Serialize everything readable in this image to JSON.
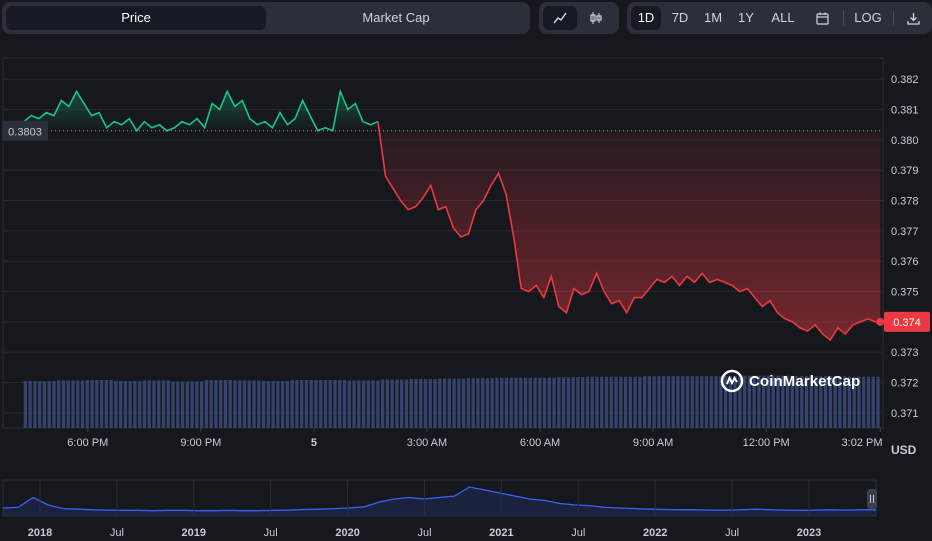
{
  "toolbar": {
    "tabs": [
      {
        "label": "Price",
        "active": true
      },
      {
        "label": "Market Cap",
        "active": false
      }
    ],
    "chart_type_icons": [
      {
        "name": "line-chart-icon",
        "active": true
      },
      {
        "name": "candlestick-icon",
        "active": false
      }
    ],
    "ranges": [
      {
        "label": "1D",
        "active": true
      },
      {
        "label": "7D",
        "active": false
      },
      {
        "label": "1M",
        "active": false
      },
      {
        "label": "1Y",
        "active": false
      },
      {
        "label": "ALL",
        "active": false
      }
    ],
    "calendar_icon": "calendar-icon",
    "log_label": "LOG",
    "download_icon": "download-icon"
  },
  "watermark": "CoinMarketCap",
  "currency_label": "USD",
  "colors": {
    "up": "#16c784",
    "down": "#ea3943",
    "volume": "#3a4a7a",
    "navigator_line": "#3861fb"
  },
  "chart_data": {
    "type": "line",
    "title": "",
    "xlabel": "",
    "ylabel": "",
    "ylim": [
      0.3705,
      0.3827
    ],
    "y_ticks": [
      0.382,
      0.381,
      0.38,
      0.379,
      0.378,
      0.377,
      0.376,
      0.375,
      0.374,
      0.373,
      0.372,
      0.371
    ],
    "y_tick_labels": [
      "0.382",
      "0.381",
      "0.380",
      "0.379",
      "0.378",
      "0.377",
      "0.376",
      "0.375",
      "0.374",
      "0.373",
      "0.372",
      "0.371"
    ],
    "x_tick_labels": [
      "6:00 PM",
      "9:00 PM",
      "5",
      "3:00 AM",
      "6:00 AM",
      "9:00 AM",
      "12:00 PM",
      "3:02 PM"
    ],
    "x_tick_hours": [
      18,
      21,
      24,
      27,
      30,
      33,
      36,
      39.03
    ],
    "reference_value": 0.3803,
    "reference_label": "0.3803",
    "current_value": 0.374,
    "current_label": "0.374",
    "grid": true,
    "series": [
      {
        "x": [
          16.3,
          16.5,
          16.7,
          16.9,
          17.1,
          17.3,
          17.5,
          17.7,
          17.9,
          18.1,
          18.3,
          18.5,
          18.7,
          18.9,
          19.1,
          19.3,
          19.5,
          19.7,
          19.9,
          20.1,
          20.3,
          20.5,
          20.7,
          20.9,
          21.1,
          21.3,
          21.5,
          21.7,
          21.9,
          22.1,
          22.3,
          22.5,
          22.7,
          22.9,
          23.1,
          23.3,
          23.5,
          23.7,
          23.9,
          24.1,
          24.3,
          24.5,
          24.7,
          24.9,
          25.1,
          25.3,
          25.5,
          25.7,
          25.9,
          26.1,
          26.3,
          26.5,
          26.7,
          26.9,
          27.1,
          27.3,
          27.5,
          27.7,
          27.9,
          28.1,
          28.3,
          28.5,
          28.7,
          28.9,
          29.1,
          29.3,
          29.5,
          29.7,
          29.9,
          30.1,
          30.3,
          30.5,
          30.7,
          30.9,
          31.1,
          31.3,
          31.5,
          31.7,
          31.9,
          32.1,
          32.3,
          32.5,
          32.7,
          32.9,
          33.1,
          33.3,
          33.5,
          33.7,
          33.9,
          34.1,
          34.3,
          34.5,
          34.7,
          34.9,
          35.1,
          35.3,
          35.5,
          35.7,
          35.9,
          36.1,
          36.3,
          36.5,
          36.7,
          36.9,
          37.1,
          37.3,
          37.5,
          37.7,
          37.9,
          38.1,
          38.3,
          38.5,
          38.7,
          38.9,
          39.03
        ],
        "y": [
          0.3806,
          0.3808,
          0.3807,
          0.3809,
          0.3808,
          0.3813,
          0.3811,
          0.3816,
          0.3812,
          0.3808,
          0.3809,
          0.3804,
          0.3806,
          0.3805,
          0.3807,
          0.3803,
          0.3806,
          0.3804,
          0.3805,
          0.3803,
          0.3804,
          0.3806,
          0.3805,
          0.3807,
          0.3804,
          0.3812,
          0.381,
          0.3816,
          0.3811,
          0.3813,
          0.3807,
          0.3805,
          0.3806,
          0.3804,
          0.3809,
          0.3805,
          0.3807,
          0.3813,
          0.3808,
          0.3803,
          0.3804,
          0.3803,
          0.3816,
          0.381,
          0.3812,
          0.3806,
          0.3805,
          0.3806,
          0.3788,
          0.3784,
          0.378,
          0.3777,
          0.3778,
          0.3781,
          0.3785,
          0.3777,
          0.3778,
          0.3771,
          0.3768,
          0.3769,
          0.3777,
          0.378,
          0.3785,
          0.3789,
          0.3782,
          0.3768,
          0.3751,
          0.375,
          0.3752,
          0.3748,
          0.3755,
          0.3745,
          0.3743,
          0.3751,
          0.3749,
          0.375,
          0.3756,
          0.375,
          0.3746,
          0.3747,
          0.3743,
          0.3748,
          0.3748,
          0.3751,
          0.3754,
          0.3753,
          0.3755,
          0.3752,
          0.3755,
          0.3753,
          0.3756,
          0.3753,
          0.3754,
          0.3753,
          0.3752,
          0.375,
          0.3751,
          0.3748,
          0.3745,
          0.3747,
          0.3743,
          0.3741,
          0.374,
          0.3738,
          0.3737,
          0.3739,
          0.3736,
          0.3734,
          0.3738,
          0.3736,
          0.3739,
          0.374,
          0.3741,
          0.374,
          0.374
        ]
      }
    ],
    "volume": {
      "x_range": [
        16.3,
        39.03
      ],
      "level": [
        0.98,
        0.99,
        1.0,
        0.98,
        0.99,
        0.97,
        1.0,
        0.99,
        0.98,
        1.0,
        1.0,
        0.99,
        1.01,
        1.02,
        1.03,
        1.04,
        1.05,
        1.05,
        1.06,
        1.07,
        1.07,
        1.08,
        1.08,
        1.08,
        1.09,
        1.09,
        1.08,
        1.08,
        1.07,
        1.07
      ]
    },
    "navigator": {
      "x_tick_labels": [
        "2018",
        "Jul",
        "2019",
        "Jul",
        "2020",
        "Jul",
        "2021",
        "Jul",
        "2022",
        "Jul",
        "2023"
      ],
      "bold_labels": [
        "2018",
        "2019",
        "2020",
        "2021",
        "2022",
        "2023"
      ],
      "level": [
        0.2,
        0.22,
        0.55,
        0.3,
        0.18,
        0.16,
        0.14,
        0.13,
        0.12,
        0.12,
        0.11,
        0.12,
        0.12,
        0.11,
        0.11,
        0.12,
        0.11,
        0.11,
        0.12,
        0.13,
        0.15,
        0.16,
        0.18,
        0.2,
        0.24,
        0.4,
        0.5,
        0.55,
        0.5,
        0.55,
        0.6,
        0.9,
        0.8,
        0.7,
        0.6,
        0.5,
        0.45,
        0.35,
        0.3,
        0.28,
        0.22,
        0.2,
        0.18,
        0.16,
        0.15,
        0.14,
        0.14,
        0.13,
        0.13,
        0.14,
        0.16,
        0.14,
        0.13,
        0.12,
        0.13,
        0.14,
        0.13,
        0.14,
        0.14
      ]
    }
  }
}
